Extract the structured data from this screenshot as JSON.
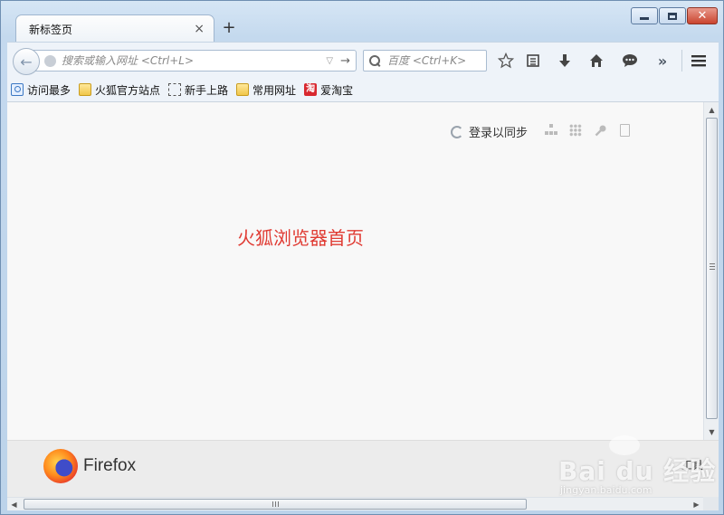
{
  "window": {
    "caption_buttons": {
      "minimize": "minimize",
      "maximize": "maximize",
      "close": "✕"
    }
  },
  "tabs": [
    {
      "title": "新标签页",
      "close": "×"
    }
  ],
  "new_tab": "+",
  "navbar": {
    "back": "←",
    "url_placeholder": "搜索或输入网址 <Ctrl+L>",
    "dropmarker": "▽",
    "go": "→",
    "search_placeholder": "百度 <Ctrl+K>",
    "icons": [
      "bookmark-star-icon",
      "reading-list-icon",
      "download-icon",
      "home-icon",
      "chat-icon",
      "overflow-icon",
      "menu-icon"
    ]
  },
  "bookmarks": [
    {
      "label": "访问最多",
      "icon": "most-visited-icon"
    },
    {
      "label": "火狐官方站点",
      "icon": "folder-icon"
    },
    {
      "label": "新手上路",
      "icon": "dotted-folder-icon"
    },
    {
      "label": "常用网址",
      "icon": "folder-icon"
    },
    {
      "label": "爱淘宝",
      "icon": "taobao-icon",
      "icon_text": "淘"
    }
  ],
  "content": {
    "sync_label": "登录以同步",
    "headline": "火狐浏览器首页",
    "headline_color": "#e03b33"
  },
  "footer": {
    "brand": "Firefox",
    "tools": "工具"
  },
  "watermark": {
    "main": "Bai du 经验",
    "sub": "jingyan.baidu.com"
  }
}
